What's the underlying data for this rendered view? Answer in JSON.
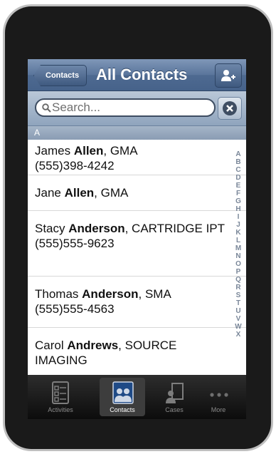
{
  "navbar": {
    "back_label": "Contacts",
    "title": "All Contacts",
    "add_contact_icon": "person-add-icon"
  },
  "search": {
    "placeholder": "Search...",
    "clear_icon": "clear-icon"
  },
  "section": {
    "letter": "A"
  },
  "contacts": [
    {
      "first": "James",
      "last": "Allen",
      "company": ", GMA",
      "phone": "(555)398-4242"
    },
    {
      "first": "Jane",
      "last": "Allen",
      "company": ", GMA",
      "phone": ""
    },
    {
      "first": "Stacy",
      "last": "Anderson",
      "company": ", CARTRIDGE IPT",
      "phone": "(555)555-9623"
    },
    {
      "first": "Thomas",
      "last": "Anderson",
      "company": ", SMA",
      "phone": "(555)555-4563"
    },
    {
      "first": "Carol",
      "last": "Andrews",
      "company": ", SOURCE IMAGING",
      "phone": ""
    }
  ],
  "index_letters": [
    "A",
    "B",
    "C",
    "D",
    "E",
    "F",
    "G",
    "H",
    "I",
    "J",
    "K",
    "L",
    "M",
    "N",
    "O",
    "P",
    "Q",
    "R",
    "S",
    "T",
    "U",
    "V",
    "W",
    "X"
  ],
  "tabs": [
    {
      "label": "Activities",
      "icon": "activities-icon",
      "active": false
    },
    {
      "label": "Contacts",
      "icon": "contacts-icon",
      "active": true
    },
    {
      "label": "Cases",
      "icon": "cases-icon",
      "active": false
    },
    {
      "label": "More",
      "icon": "more-icon",
      "active": false
    }
  ]
}
